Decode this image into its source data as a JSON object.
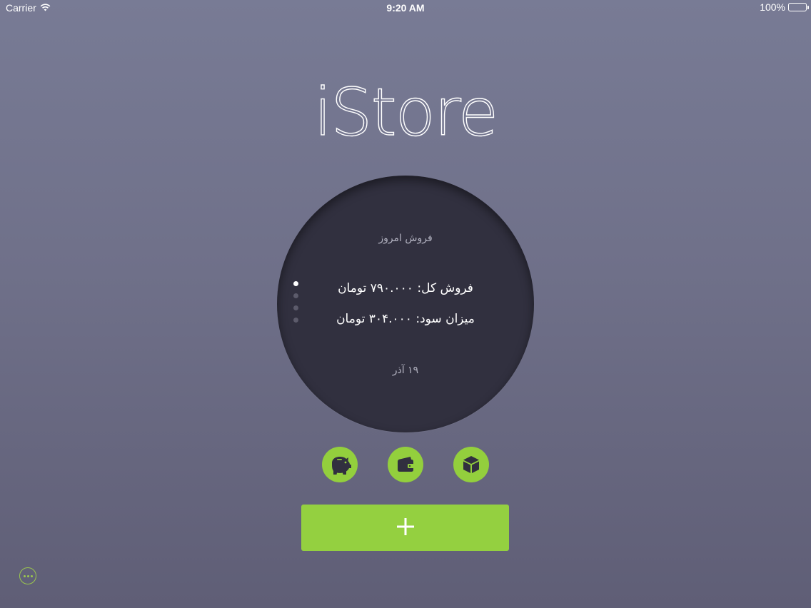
{
  "status_bar": {
    "carrier": "Carrier",
    "time": "9:20 AM",
    "battery": "100%",
    "battery_level": 1.0,
    "icons": [
      "wifi-icon",
      "battery-icon"
    ]
  },
  "app": {
    "title": "iStore"
  },
  "summary": {
    "heading": "فروش امروز",
    "total_sales": "فروش کل: ۷۹۰.۰۰۰ تومان",
    "profit": "میزان سود: ۳۰۴.۰۰۰ تومان",
    "date": "۱۹ آذر",
    "pages": 4,
    "current_page": 1
  },
  "actions": [
    {
      "icon": "piggy-bank-icon"
    },
    {
      "icon": "wallet-icon"
    },
    {
      "icon": "box-icon"
    }
  ],
  "add_button": {
    "icon": "plus-icon"
  },
  "more_button": {
    "icon": "more-icon"
  },
  "colors": {
    "accent": "#94d040",
    "circle": "#31303f",
    "background_top": "#787b95",
    "background_bottom": "#5f5e76"
  }
}
